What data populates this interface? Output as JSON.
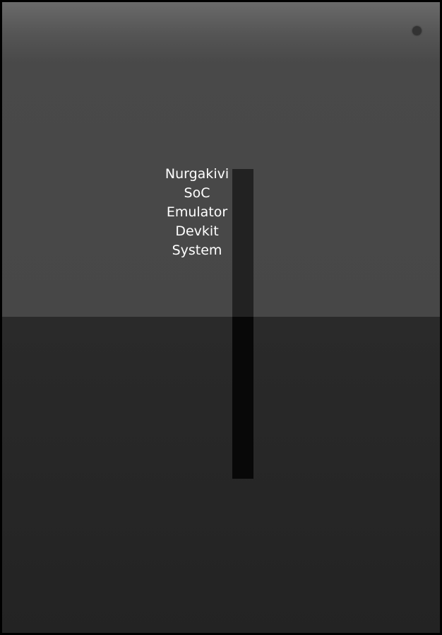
{
  "title_lines": [
    "Nurgakivi",
    "SoC",
    "Emulator",
    "Devkit",
    "System"
  ],
  "indicator": {
    "icon": "status-dot-icon",
    "color": "#333333"
  }
}
